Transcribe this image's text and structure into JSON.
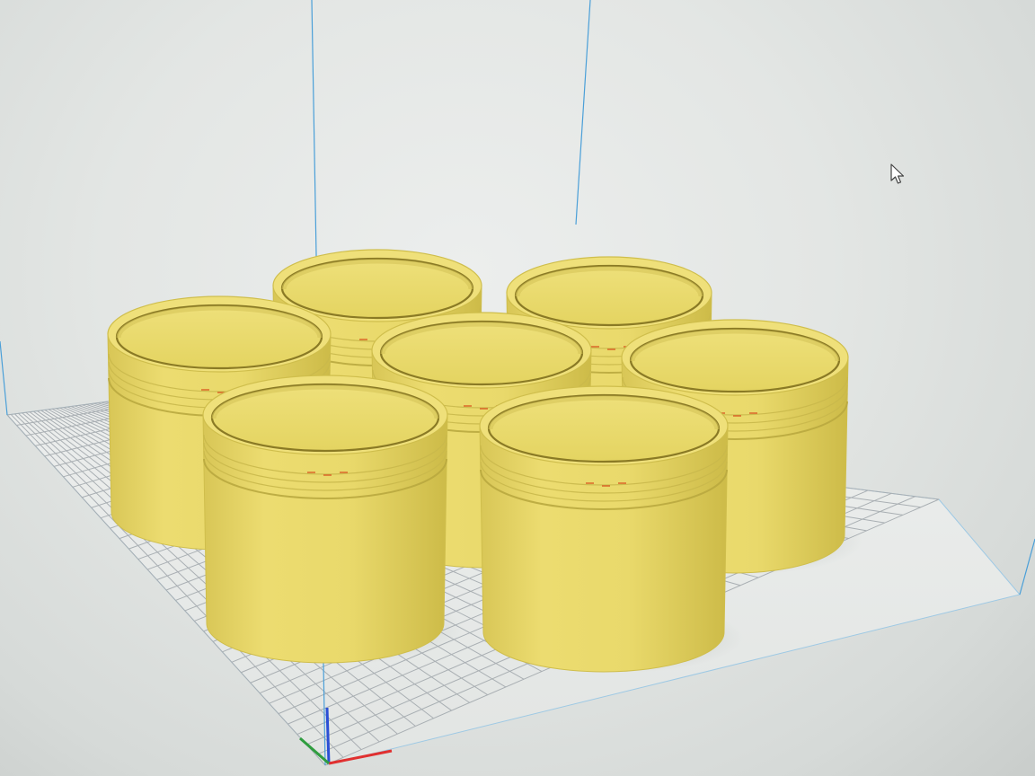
{
  "app": {
    "view": "3d-viewport"
  },
  "colors": {
    "background": "#e3e6e4",
    "build_plate": "#e9ecea",
    "grid_line": "#a9afb3",
    "volume_edge": "#4a9fd8",
    "model_fill": "#e6d766",
    "model_shade": "#cfbe4c",
    "model_dark": "#8a7a25",
    "seam": "#d9531e",
    "axis_x": "#e03030",
    "axis_y": "#2f9d3f",
    "axis_z": "#2a4fd6"
  },
  "icons": {
    "cursor": "mouse-pointer-icon",
    "axes": "xyz-axes-icon"
  },
  "models": {
    "count": 6,
    "shape": "jar"
  }
}
